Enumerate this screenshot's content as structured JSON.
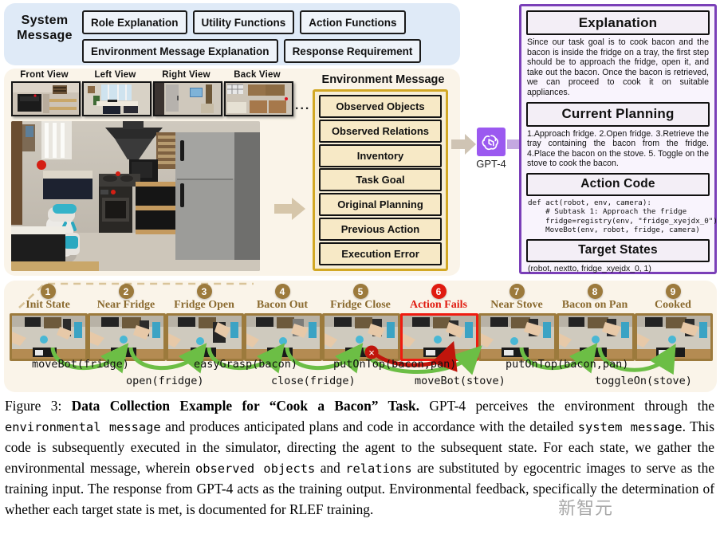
{
  "system_message": {
    "title": "System\nMessage",
    "title_line1": "System",
    "title_line2": "Message",
    "chips_row1": [
      "Role Explanation",
      "Utility Functions",
      "Action Functions"
    ],
    "chips_row2": [
      "Environment Message Explanation",
      "Response Requirement"
    ]
  },
  "views": {
    "labels": [
      "Front View",
      "Left View",
      "Right View",
      "Back View"
    ],
    "ellipsis": "..."
  },
  "environment_message": {
    "title": "Environment Message",
    "items": [
      "Observed Objects",
      "Observed Relations",
      "Inventory",
      "Task Goal",
      "Original Planning",
      "Previous Action",
      "Execution Error"
    ]
  },
  "model": {
    "name": "GPT-4",
    "icon": "openai-logo-icon",
    "accent_color": "#9b59f0"
  },
  "response": {
    "explanation_title": "Explanation",
    "explanation_body": "Since our task goal is to cook bacon and the bacon is inside the fridge on a tray, the first step should be to approach the fridge, open it, and take out the bacon. Once the bacon is retrieved, we can proceed to cook it on suitable appliances.",
    "planning_title": "Current Planning",
    "planning_body": "1.Approach fridge. 2.Open fridge. 3.Retrieve the tray containing the bacon from the fridge. 4.Place the bacon on the stove. 5. Toggle on the stove to cook the bacon.",
    "code_title": "Action Code",
    "code_body": "def act(robot, env, camera):\n    # Subtask 1: Approach the fridge\n    fridge=registry(env, \"fridge_xyejdx_0\")\n    MoveBot(env, robot, fridge, camera)",
    "target_title": "Target States",
    "target_body": "(robot, nextto, fridge_xyejdx_0, 1)"
  },
  "timeline": {
    "states": [
      {
        "num": "1",
        "label": "Init State",
        "failed": false
      },
      {
        "num": "2",
        "label": "Near Fridge",
        "failed": false
      },
      {
        "num": "3",
        "label": "Fridge Open",
        "failed": false
      },
      {
        "num": "4",
        "label": "Bacon Out",
        "failed": false
      },
      {
        "num": "5",
        "label": "Fridge Close",
        "failed": false
      },
      {
        "num": "6",
        "label": "Action Fails",
        "failed": true
      },
      {
        "num": "7",
        "label": "Near Stove",
        "failed": false
      },
      {
        "num": "8",
        "label": "Bacon on Pan",
        "failed": false
      },
      {
        "num": "9",
        "label": "Cooked",
        "failed": false
      }
    ],
    "actions_upper": [
      "moveBot(fridge)",
      "easyGrasp(bacon)",
      "putOnTop(bacon,pan)",
      "putOnTop(bacon,pan)"
    ],
    "actions_lower": [
      "open(fridge)",
      "close(fridge)",
      "moveBot(stove)",
      "toggleOn(stove)"
    ],
    "fail_marker": "×",
    "success_color": "#6cbe45",
    "fail_color": "#c0150c"
  },
  "caption": {
    "figure_number": "Figure 3:",
    "bold_title": "Data Collection Example for “Cook a Bacon” Task.",
    "part1": " GPT-4 perceives the environment through the ",
    "mono1": "environmental message",
    "part2": " and produces anticipated plans and code in accordance with the detailed ",
    "mono2": "system message",
    "part3": ". This code is subsequently executed in the simulator, directing the agent to the subsequent state. For each state, we gather the environmental message, wherein ",
    "mono3": "observed objects",
    "part4": " and ",
    "mono4": "relations",
    "part5": " are substituted by egocentric images to serve as the training input. The response from GPT-4 acts as the training output. Environmental feedback, specifically the determination of whether each target state is met, is documented for RLEF training."
  },
  "watermark": {
    "text": "新智元"
  }
}
